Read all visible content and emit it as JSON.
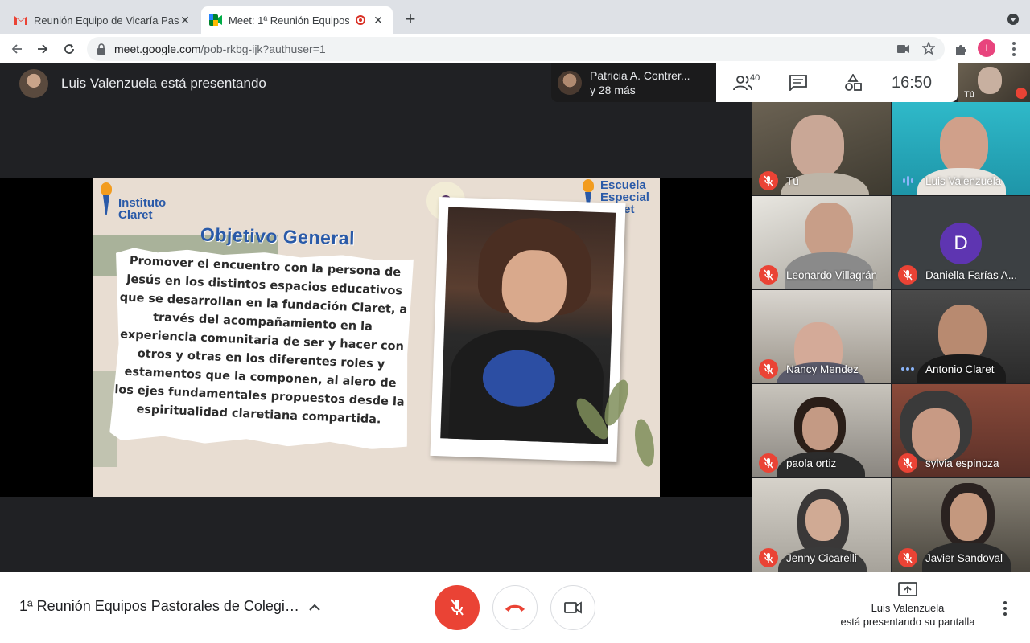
{
  "browser": {
    "tabs": [
      {
        "title": "Reunión Equipo de Vicaría Past",
        "icon": "gmail-icon"
      },
      {
        "title": "Meet: 1ª Reunión Equipos P",
        "icon": "meet-icon",
        "recording": true
      }
    ],
    "url_host": "meet.google.com",
    "url_path": "/pob-rkbg-ijk?authuser=1",
    "profile_initial": "I",
    "colors": {
      "profile": "#e8447d",
      "tabbar": "#dee1e6"
    }
  },
  "meet": {
    "presenter_text": "Luis Valenzuela está presentando",
    "participants_pill": {
      "name": "Patricia A. Contrer...",
      "more": "y 28 más"
    },
    "participant_count": "40",
    "clock": "16:50",
    "self_label": "Tú",
    "slide": {
      "logo_left": [
        "Instituto",
        "Claret"
      ],
      "logo_right": [
        "Escuela",
        "Especial",
        "Claret"
      ],
      "title": "Objetivo General",
      "body": "Promover el encuentro con la persona de Jesús en los distintos espacios educativos que se desarrollan en la fundación Claret, a través del acompañamiento en la experiencia comunitaria de ser y hacer con otros y otras en los diferentes roles y estamentos que la componen, al alero de los ejes fundamentales propuestos desde la espiritualidad claretiana compartida.",
      "colors": {
        "title": "#2a5aa8",
        "background": "#e8ddd2"
      }
    },
    "participants": [
      {
        "name": "Tú",
        "status": "muted"
      },
      {
        "name": "Luis Valenzuela",
        "status": "speaking"
      },
      {
        "name": "Leonardo Villagrán",
        "status": "muted"
      },
      {
        "name": "Daniella Farías A...",
        "status": "muted",
        "avatar_letter": "D"
      },
      {
        "name": "Nancy Mendez",
        "status": "muted"
      },
      {
        "name": "Antonio Claret",
        "status": "active"
      },
      {
        "name": "paola ortiz",
        "status": "muted"
      },
      {
        "name": "sylvia espinoza",
        "status": "muted"
      },
      {
        "name": "Jenny Cicarelli",
        "status": "muted"
      },
      {
        "name": "Javier Sandoval",
        "status": "muted"
      }
    ],
    "bottom": {
      "meeting_title": "1ª Reunión Equipos Pastorales de Colegio...",
      "present_line1": "Luis Valenzuela",
      "present_line2": "está presentando su pantalla"
    },
    "colors": {
      "mic_muted": "#ea4335",
      "speaking_border": "#4ecdc4",
      "avatar_d": "#5e35b1"
    }
  }
}
